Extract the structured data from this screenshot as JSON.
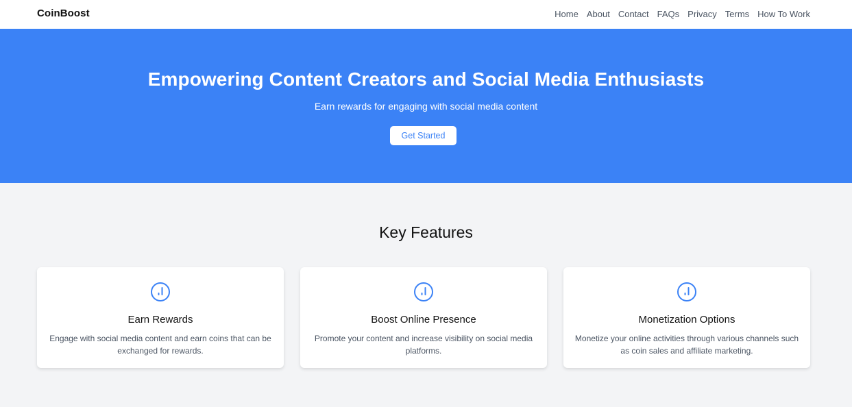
{
  "header": {
    "brand": "CoinBoost",
    "nav": [
      "Home",
      "About",
      "Contact",
      "FAQs",
      "Privacy",
      "Terms",
      "How To Work"
    ]
  },
  "hero": {
    "title": "Empowering Content Creators and Social Media Enthusiasts",
    "subtitle": "Earn rewards for engaging with social media content",
    "cta_label": "Get Started"
  },
  "features": {
    "heading": "Key Features",
    "items": [
      {
        "icon": "chart-circle-icon",
        "title": "Earn Rewards",
        "description": "Engage with social media content and earn coins that can be exchanged for rewards."
      },
      {
        "icon": "chart-circle-icon",
        "title": "Boost Online Presence",
        "description": "Promote your content and increase visibility on social media platforms."
      },
      {
        "icon": "chart-circle-icon",
        "title": "Monetization Options",
        "description": "Monetize your online activities through various channels such as coin sales and affiliate marketing."
      }
    ]
  },
  "colors": {
    "primary": "#3b82f6",
    "background": "#f3f4f6",
    "card": "#ffffff"
  }
}
